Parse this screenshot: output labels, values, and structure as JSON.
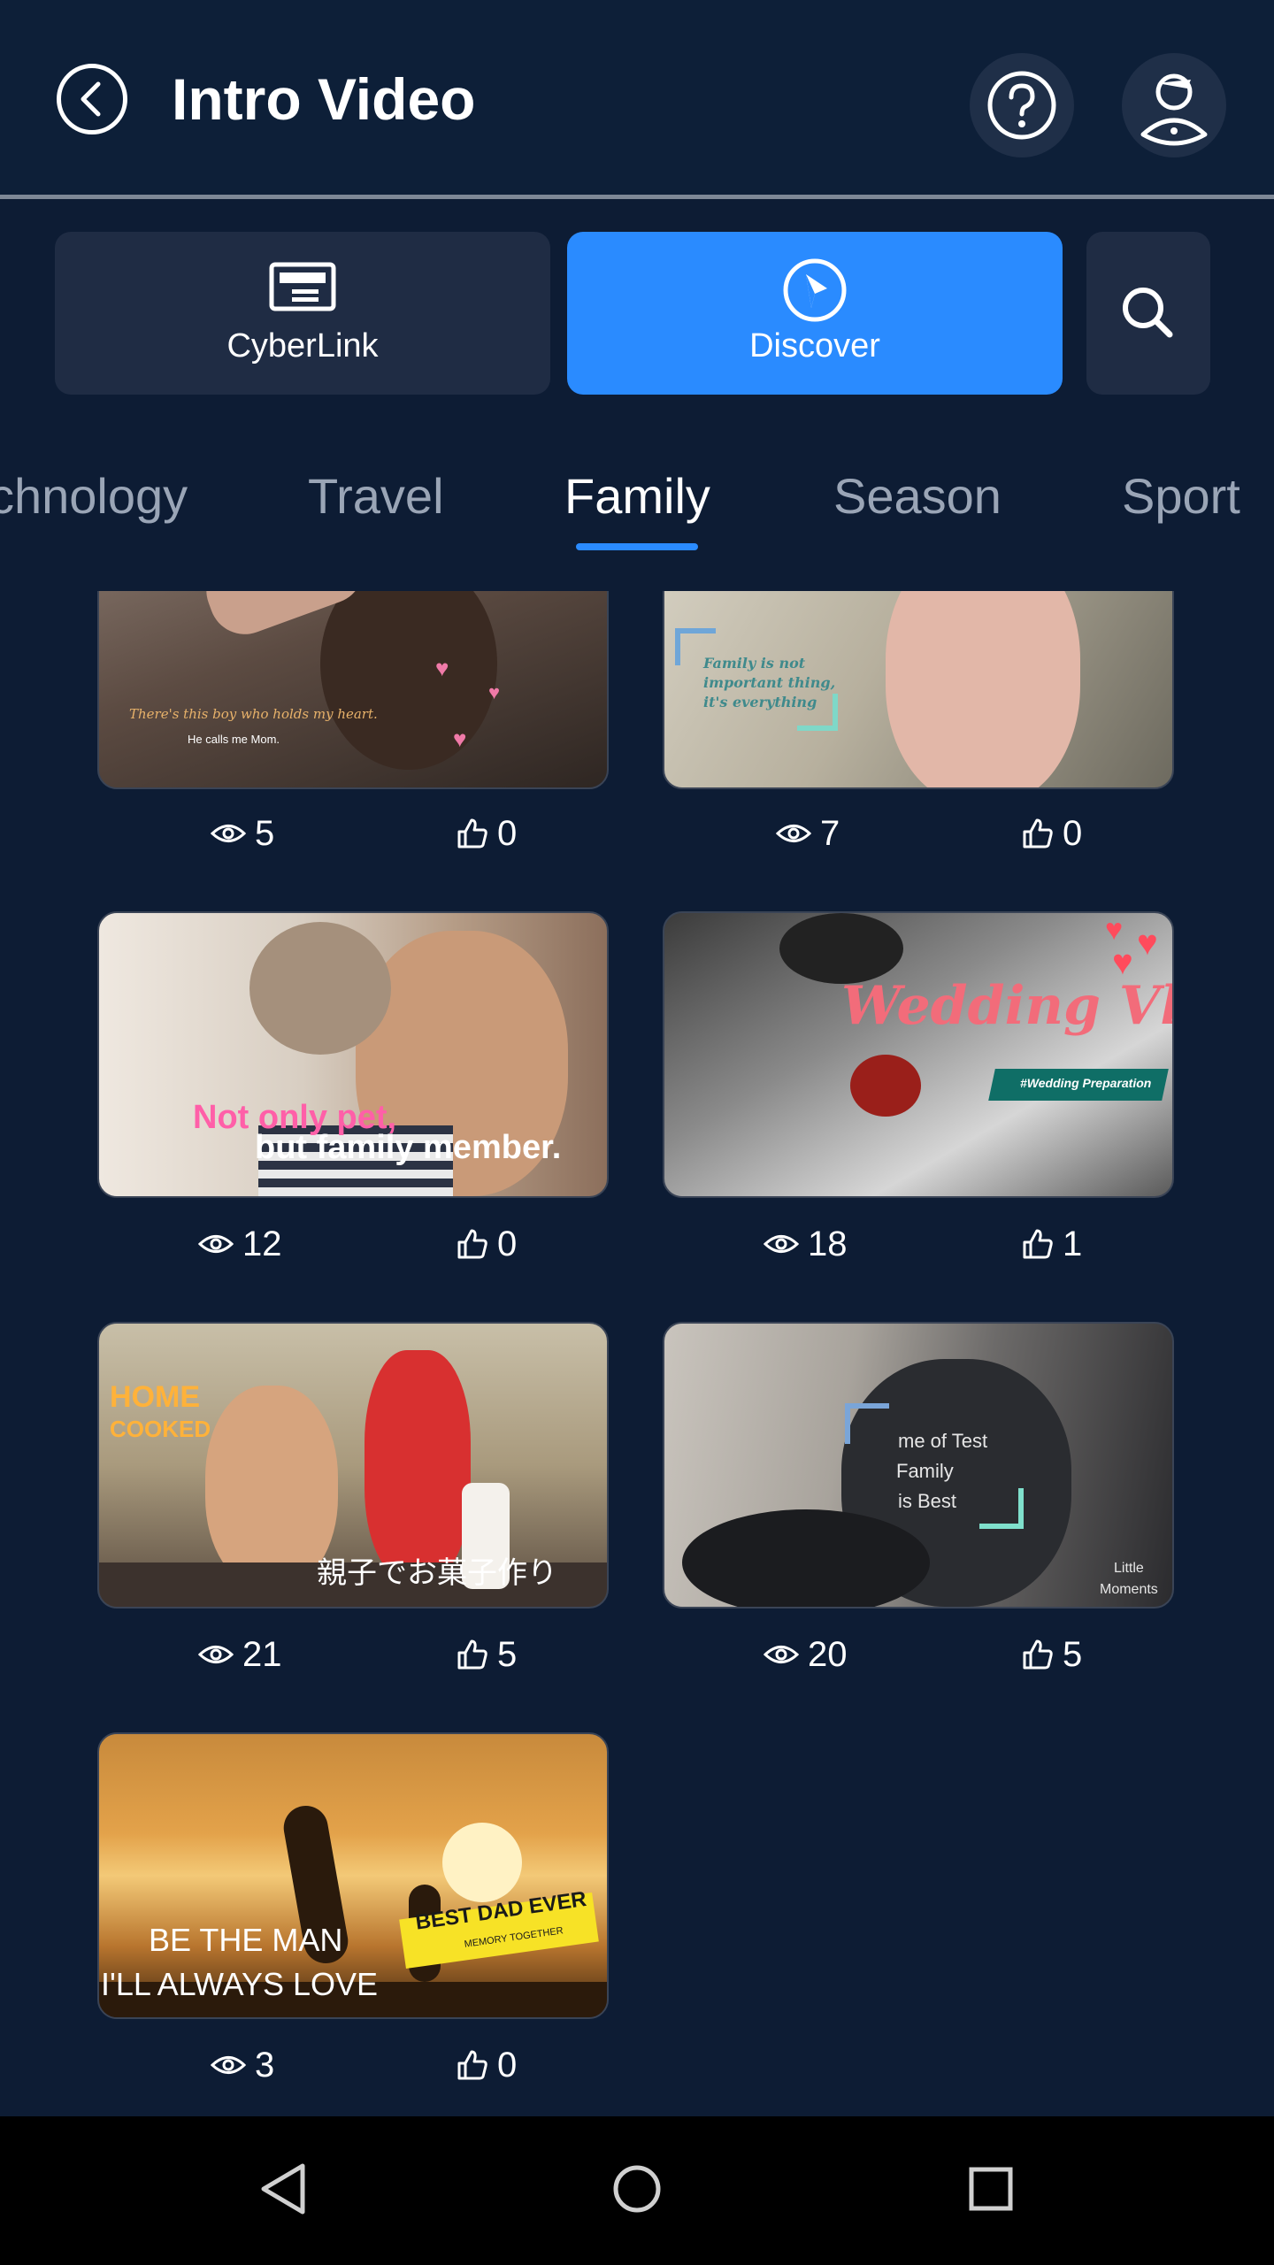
{
  "header": {
    "title": "Intro Video"
  },
  "modes": {
    "cyberlink": "CyberLink",
    "discover": "Discover"
  },
  "categories": [
    "chnology",
    "Travel",
    "Family",
    "Season",
    "Sport"
  ],
  "active_category": "Family",
  "cards": [
    {
      "views": "5",
      "likes": "0",
      "overlay": [
        "There's this boy who holds my heart.",
        "He calls me Mom."
      ]
    },
    {
      "views": "7",
      "likes": "0",
      "overlay": [
        "Family is not",
        "important thing,",
        "it's everything"
      ]
    },
    {
      "views": "12",
      "likes": "0",
      "overlay": [
        "Not only pet,",
        "but family member."
      ]
    },
    {
      "views": "18",
      "likes": "1",
      "overlay": [
        "Wedding Vlog",
        "#Wedding Preparation"
      ]
    },
    {
      "views": "21",
      "likes": "5",
      "overlay": [
        "HOME",
        "COOKED",
        "親子でお菓子作り"
      ]
    },
    {
      "views": "20",
      "likes": "5",
      "overlay": [
        "me of Test",
        "Family",
        "is Best",
        "Little",
        "Moments"
      ]
    },
    {
      "views": "3",
      "likes": "0",
      "overlay": [
        "BE THE MAN",
        "I'LL ALWAYS LOVE",
        "BEST DAD EVER",
        "MEMORY TOGETHER"
      ]
    }
  ],
  "colors": {
    "accent": "#2a8bff",
    "background": "#0d1c34",
    "tile": "#1f2c44"
  }
}
